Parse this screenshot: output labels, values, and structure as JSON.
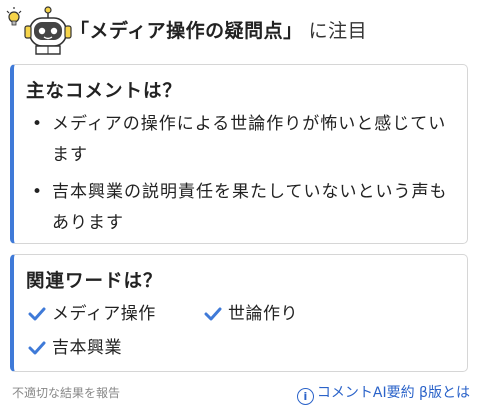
{
  "header": {
    "title": "「メディア操作の疑問点」",
    "suffix": "に注目"
  },
  "comments_card": {
    "heading": "主なコメントは？",
    "items": [
      "メディアの操作による世論作りが怖いと感じています",
      "吉本興業の説明責任を果たしていないという声もあります"
    ]
  },
  "words_card": {
    "heading": "関連ワードは？",
    "items": [
      "メディア操作",
      "世論作り",
      "吉本興業"
    ]
  },
  "footer": {
    "report_link": "不適切な結果を報告",
    "about_link": "コメントAI要約 β版とは"
  },
  "colors": {
    "accent": "#3f7ad8",
    "link": "#2b63c9",
    "check": "#3f7ad8"
  },
  "icons": {
    "mascot": "robot-mascot-icon",
    "check": "check-icon",
    "info": "info-icon"
  }
}
